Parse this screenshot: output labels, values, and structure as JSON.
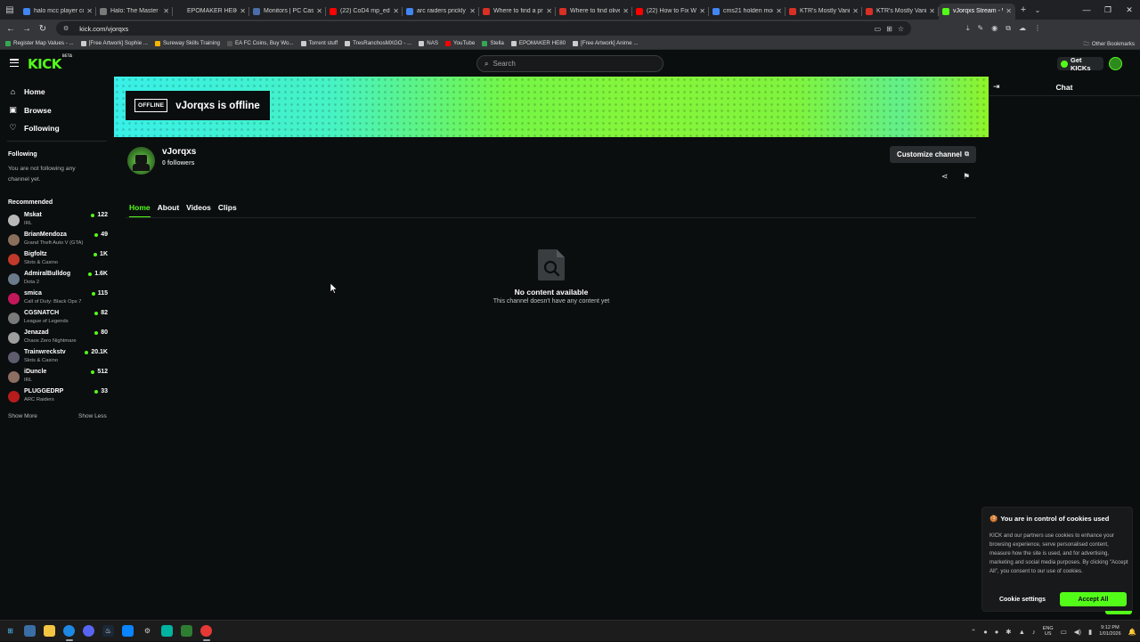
{
  "browser": {
    "tabs": [
      {
        "title": "halo mcc player count",
        "color": "#4285f4"
      },
      {
        "title": "Halo: The Master Chief",
        "color": "#7a7a7a"
      },
      {
        "title": "EPOMAKER HE80",
        "color": "#202124"
      },
      {
        "title": "Monitors | PC Case Ge",
        "color": "#4a6ea9"
      },
      {
        "title": "(22) CoD4 mp_edge V",
        "color": "#ff0000"
      },
      {
        "title": "arc raiders prickly pea",
        "color": "#4285f4"
      },
      {
        "title": "Where to find a prickl",
        "color": "#d93025"
      },
      {
        "title": "Where to find olives i",
        "color": "#d93025"
      },
      {
        "title": "(22) How to Fix Washe",
        "color": "#ff0000"
      },
      {
        "title": "cms21 holden mods",
        "color": "#4285f4"
      },
      {
        "title": "KTR's Mostly Vanilla C",
        "color": "#d93025"
      },
      {
        "title": "KTR's Mostly Vanilla C",
        "color": "#d93025"
      },
      {
        "title": "vJorqxs Stream - Wat",
        "color": "#53fc18"
      }
    ],
    "url": "kick.com/vjorqxs",
    "bookmarks": [
      {
        "label": "Register Map Values - ...",
        "color": "#34a853"
      },
      {
        "label": "[Free Artwork] Sophie ...",
        "color": "#ccc"
      },
      {
        "label": "Sureway Skills Training",
        "color": "#f4b400"
      },
      {
        "label": "EA FC Coins, Buy Wo...",
        "color": "#555"
      },
      {
        "label": "Torrent stuff",
        "color": "#ccc"
      },
      {
        "label": "TresRanchosMXGO - ...",
        "color": "#ccc"
      },
      {
        "label": "NAS",
        "color": "#ccc"
      },
      {
        "label": "YouTube",
        "color": "#ff0000"
      },
      {
        "label": "Stella",
        "color": "#34a853"
      },
      {
        "label": "EPOMAKER HE80",
        "color": "#ccc"
      },
      {
        "label": "[Free Artwork] Anime ...",
        "color": "#ccc"
      }
    ],
    "other_bookmarks": "Other Bookmarks"
  },
  "header": {
    "logo": "KICK",
    "logo_badge": "BETA",
    "search_placeholder": "Search",
    "get_kicks": "Get KICKs",
    "accent": "#53fc18"
  },
  "sidebar": {
    "nav": [
      {
        "label": "Home",
        "icon": "home-icon"
      },
      {
        "label": "Browse",
        "icon": "browse-icon"
      },
      {
        "label": "Following",
        "icon": "heart-icon"
      }
    ],
    "following_heading": "Following",
    "following_empty": "You are not following any channel yet.",
    "recommended_heading": "Recommended",
    "recommended": [
      {
        "name": "Mskat",
        "category": "IRL",
        "viewers": "122",
        "color": "#b8b8b8"
      },
      {
        "name": "BrianMendoza",
        "category": "Grand Theft Auto V (GTA)",
        "viewers": "49",
        "color": "#8a6f5a"
      },
      {
        "name": "Bigfoltz",
        "category": "Slots & Casino",
        "viewers": "1K",
        "color": "#c0392b"
      },
      {
        "name": "AdmiralBulldog",
        "category": "Dota 2",
        "viewers": "1.6K",
        "color": "#6b7b8c"
      },
      {
        "name": "smica",
        "category": "Call of Duty: Black Ops 7",
        "viewers": "115",
        "color": "#c2185b"
      },
      {
        "name": "CGSNATCH",
        "category": "League of Legends",
        "viewers": "82",
        "color": "#7a7a7a"
      },
      {
        "name": "Jenazad",
        "category": "Chaos Zero Nightmare",
        "viewers": "80",
        "color": "#9e9e9e"
      },
      {
        "name": "Trainwreckstv",
        "category": "Slots & Casino",
        "viewers": "20.1K",
        "color": "#5d5d6e"
      },
      {
        "name": "iDuncle",
        "category": "IRL",
        "viewers": "512",
        "color": "#8d6e63"
      },
      {
        "name": "PLUGGEDRP",
        "category": "ARC Raiders",
        "viewers": "33",
        "color": "#b71c1c"
      }
    ],
    "show_more": "Show More",
    "show_less": "Show Less"
  },
  "channel": {
    "offline_badge": "OFFLINE",
    "offline_text": "vJorqxs is offline",
    "name": "vJorqxs",
    "followers": "0 followers",
    "customize": "Customize channel",
    "tabs": [
      "Home",
      "About",
      "Videos",
      "Clips"
    ],
    "active_tab": 0,
    "empty_title": "No content available",
    "empty_subtitle": "This channel doesn't have any content yet"
  },
  "chat": {
    "title": "Chat"
  },
  "cookie": {
    "title": "You are in control of cookies used",
    "body": "KICK and our partners use cookies to enhance your browsing experience, serve personalised content, measure how the site is used, and for advertising, marketing and social media purposes. By clicking \"Accept All\", you consent to our use of cookies.",
    "settings": "Cookie settings",
    "accept": "Accept All"
  },
  "taskbar": {
    "lang_top": "ENG",
    "lang_bottom": "US",
    "time": "9:12 PM",
    "date": "1/01/2026"
  }
}
